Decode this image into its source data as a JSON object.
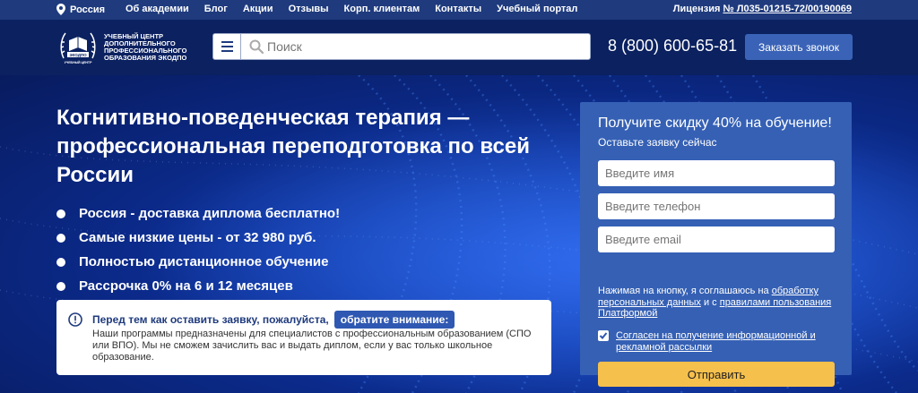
{
  "topbar": {
    "location": "Россия",
    "nav": [
      "Об академии",
      "Блог",
      "Акции",
      "Отзывы",
      "Корп. клиентам",
      "Контакты",
      "Учебный портал"
    ],
    "license_label": "Лицензия",
    "license_number": "№ Л035-01215-72/00190069"
  },
  "header": {
    "logo_text": "Учебный центр дополнительного профессионального образования Экодпо",
    "logo_emblem_top": "ЭКОДПО",
    "logo_emblem_bottom": "УЧЕБНЫЙ ЦЕНТР",
    "search_placeholder": "Поиск",
    "phone": "8 (800) 600-65-81",
    "call_button": "Заказать звонок"
  },
  "hero": {
    "title": "Когнитивно-поведенческая терапия — профессиональная переподготовка по всей России",
    "bullets": [
      "Россия - доставка диплома бесплатно!",
      "Самые низкие цены - от 32 980 руб.",
      "Полностью дистанционное обучение",
      "Рассрочка 0% на 6 и 12 месяцев"
    ],
    "notice": {
      "head": "Перед тем как оставить заявку, пожалуйста,",
      "badge": "обратите внимание:",
      "body": "Наши программы предназначены для специалистов с профессиональным образованием (СПО или ВПО). Мы не сможем зачислить вас и выдать диплом, если у вас только школьное образование."
    }
  },
  "form": {
    "heading": "Получите скидку 40% на обучение!",
    "subheading": "Оставьте заявку сейчас",
    "name_placeholder": "Введите имя",
    "phone_placeholder": "Введите телефон",
    "email_placeholder": "Введите email",
    "agree_prefix": "Нажимая на кнопку, я соглашаюсь на ",
    "agree_link1": "обработку персональных данных",
    "agree_mid": " и с ",
    "agree_link2": "правилами пользования Платформой",
    "consent": "Согласен на получение информационной и рекламной рассылки",
    "consent_checked": true,
    "submit": "Отправить"
  },
  "colors": {
    "topbar": "#1f3b7e",
    "header": "#0b2160",
    "form_bg": "#3560b4",
    "submit": "#f6c04c",
    "badge": "#2f58b2"
  }
}
